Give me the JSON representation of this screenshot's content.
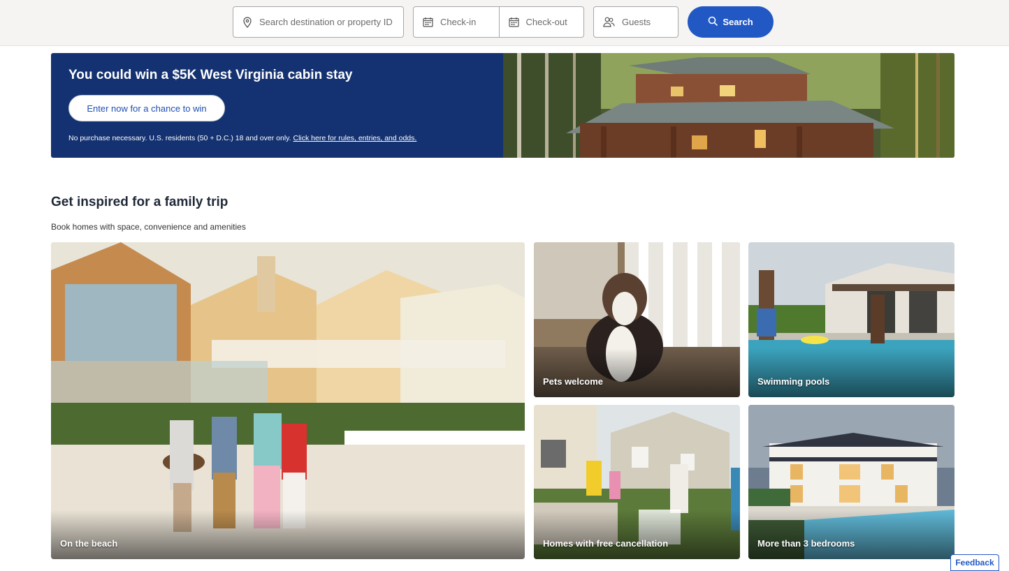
{
  "search_bar": {
    "destination_placeholder": "Search destination or property ID",
    "destination_icon": "map-pin-icon",
    "checkin_placeholder": "Check-in",
    "checkout_placeholder": "Check-out",
    "calendar_icon": "calendar-icon",
    "guests_placeholder": "Guests",
    "guests_icon": "people-icon",
    "search_label": "Search",
    "search_icon": "search-icon"
  },
  "promo": {
    "title": "You could win a $5K West Virginia cabin stay",
    "cta_label": "Enter now for a chance to win",
    "fine_print": "No purchase necessary. U.S. residents (50 + D.C.) 18 and over only.",
    "rules_link": "Click here for rules, entries, and odds."
  },
  "inspiration": {
    "title": "Get inspired for a family trip",
    "subtitle": "Book homes with space, convenience and amenities",
    "cards": [
      {
        "label": "On the beach"
      },
      {
        "label": "Pets welcome"
      },
      {
        "label": "Swimming pools"
      },
      {
        "label": "Homes with free cancellation"
      },
      {
        "label": "More than 3 bedrooms"
      }
    ]
  },
  "feedback_label": "Feedback",
  "colors": {
    "brand_blue": "#2258c4",
    "banner_navy": "#143271"
  }
}
